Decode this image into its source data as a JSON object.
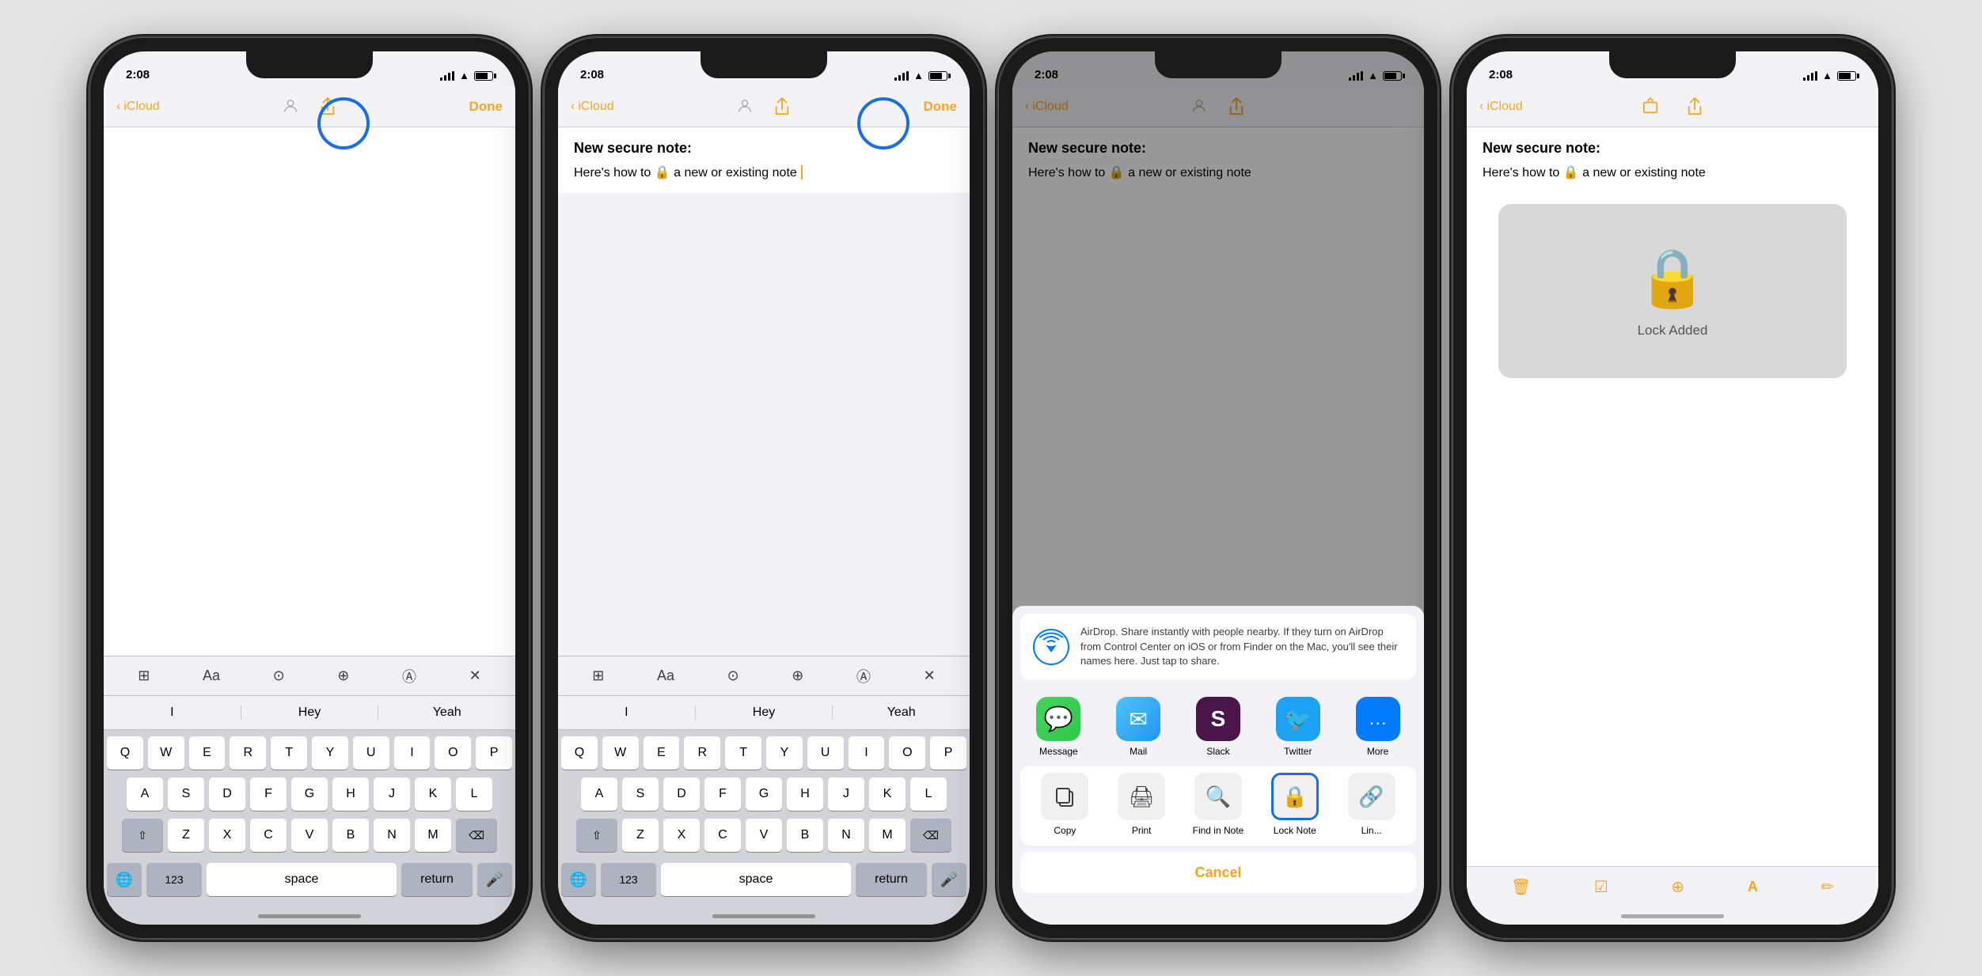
{
  "background_color": "#e5e5e5",
  "phones": [
    {
      "id": "phone1",
      "status_time": "2:08",
      "nav_back": "iCloud",
      "nav_done": "Done",
      "has_blue_circle": true,
      "blue_circle_position": "share",
      "content_type": "empty_note",
      "has_keyboard": true,
      "suggestions": [
        "I",
        "Hey",
        "Yeah"
      ],
      "keyboard_rows": [
        [
          "Q",
          "W",
          "E",
          "R",
          "T",
          "Y",
          "U",
          "I",
          "O",
          "P"
        ],
        [
          "A",
          "S",
          "D",
          "F",
          "G",
          "H",
          "J",
          "K",
          "L"
        ],
        [
          "⇧",
          "Z",
          "X",
          "C",
          "V",
          "B",
          "N",
          "M",
          "⌫"
        ],
        [
          "123",
          "space",
          "return"
        ]
      ]
    },
    {
      "id": "phone2",
      "status_time": "2:08",
      "nav_back": "iCloud",
      "nav_done": "Done",
      "has_blue_circle": true,
      "blue_circle_position": "share",
      "content_type": "note_with_content",
      "note_title": "New secure note:",
      "note_body": "Here's how to 🔒 a new or existing note",
      "has_keyboard": true,
      "suggestions": [
        "I",
        "Hey",
        "Yeah"
      ],
      "keyboard_rows": [
        [
          "Q",
          "W",
          "E",
          "R",
          "T",
          "Y",
          "U",
          "I",
          "O",
          "P"
        ],
        [
          "A",
          "S",
          "D",
          "F",
          "G",
          "H",
          "J",
          "K",
          "L"
        ],
        [
          "⇧",
          "Z",
          "X",
          "C",
          "V",
          "B",
          "N",
          "M",
          "⌫"
        ],
        [
          "123",
          "space",
          "return"
        ]
      ]
    },
    {
      "id": "phone3",
      "status_time": "2:08",
      "nav_back": "iCloud",
      "nav_done": "",
      "content_type": "share_sheet",
      "note_title": "New secure note:",
      "note_body": "Here's how to 🔒 a new or existing note",
      "airdrop_text": "AirDrop. Share instantly with people nearby. If they turn on AirDrop from Control Center on iOS or from Finder on the Mac, you'll see their names here. Just tap to share.",
      "share_apps": [
        {
          "label": "Message",
          "icon": "💬",
          "bg": "messages"
        },
        {
          "label": "Mail",
          "icon": "✉️",
          "bg": "mail"
        },
        {
          "label": "Slack",
          "icon": "S",
          "bg": "slack"
        },
        {
          "label": "Twitter",
          "icon": "🐦",
          "bg": "twitter"
        }
      ],
      "share_actions": [
        {
          "label": "Copy",
          "icon": "⧉"
        },
        {
          "label": "Print",
          "icon": "🖨"
        },
        {
          "label": "Find in Note",
          "icon": "🔍"
        },
        {
          "label": "Lock Note",
          "icon": "🔒",
          "highlighted": true
        },
        {
          "label": "Lin...",
          "icon": "🔗"
        }
      ],
      "cancel_label": "Cancel"
    },
    {
      "id": "phone4",
      "status_time": "2:08",
      "nav_back": "iCloud",
      "content_type": "lock_added",
      "note_title": "New secure note:",
      "note_body": "Here's how to 🔒 a new or existing note",
      "lock_added_label": "Lock Added",
      "bottom_icons": [
        "🗑",
        "✓",
        "⊕",
        "A",
        "✏"
      ]
    }
  ]
}
